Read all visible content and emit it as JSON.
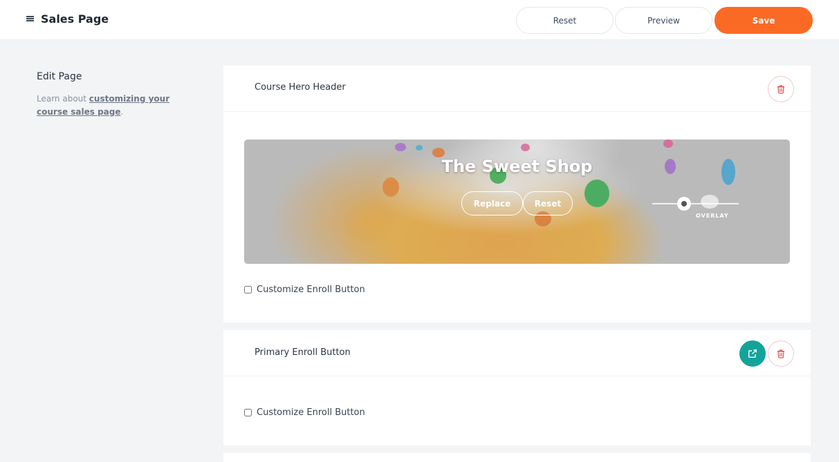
{
  "header": {
    "title": "Sales Page",
    "buttons": {
      "reset": "Reset",
      "preview": "Preview",
      "save": "Save"
    },
    "save_color": "#fb6a24"
  },
  "sidebar": {
    "title": "Edit Page",
    "help_prefix": "Learn about ",
    "help_link": "customizing your course sales page",
    "help_suffix": "."
  },
  "sections": [
    {
      "title": "Course Hero Header",
      "hero": {
        "title": "The Sweet Shop",
        "replace_label": "Replace",
        "reset_label": "Reset",
        "overlay_label": "OVERLAY",
        "overlay_value": 0.37
      },
      "checkbox_label": "Customize Enroll Button",
      "checked": false
    },
    {
      "title": "Primary Enroll Button",
      "checkbox_label": "Customize Enroll Button",
      "checked": false
    }
  ],
  "icons": {
    "menu": "menu-icon",
    "delete": "trash-icon",
    "open_external": "external-link-icon"
  },
  "colors": {
    "accent_teal": "#14a39a",
    "danger": "#e05a5a"
  }
}
